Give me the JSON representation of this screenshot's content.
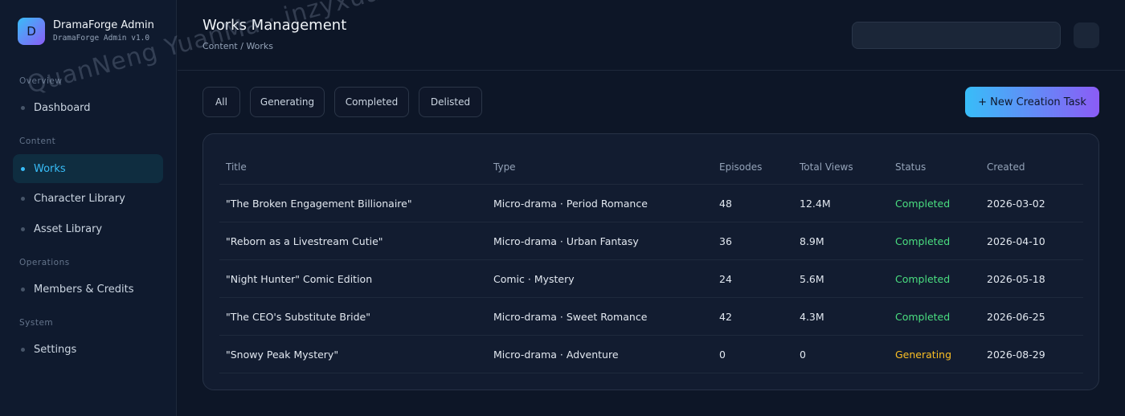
{
  "brand": {
    "logo_letter": "D",
    "title": "DramaForge Admin",
    "subtitle": "DramaForge Admin v1.0"
  },
  "sidebar": {
    "sections": [
      {
        "label": "Overview",
        "items": [
          {
            "label": "Dashboard"
          }
        ]
      },
      {
        "label": "Content",
        "items": [
          {
            "label": "Works",
            "active": true
          },
          {
            "label": "Character Library"
          },
          {
            "label": "Asset Library"
          }
        ]
      },
      {
        "label": "Operations",
        "items": [
          {
            "label": "Members & Credits"
          }
        ]
      },
      {
        "label": "System",
        "items": [
          {
            "label": "Settings"
          }
        ]
      }
    ]
  },
  "header": {
    "title": "Works Management",
    "breadcrumb": "Content / Works"
  },
  "filters": [
    "All",
    "Generating",
    "Completed",
    "Delisted"
  ],
  "new_task_label": "+ New Creation Task",
  "table": {
    "columns": [
      "Title",
      "Type",
      "Episodes",
      "Total Views",
      "Status",
      "Created"
    ],
    "rows": [
      {
        "title": "\"The Broken Engagement Billionaire\"",
        "type": "Micro-drama · Period Romance",
        "episodes": "48",
        "views": "12.4M",
        "status": "Completed",
        "created": "2026-03-02"
      },
      {
        "title": "\"Reborn as a Livestream Cutie\"",
        "type": "Micro-drama · Urban Fantasy",
        "episodes": "36",
        "views": "8.9M",
        "status": "Completed",
        "created": "2026-04-10"
      },
      {
        "title": "\"Night Hunter\" Comic Edition",
        "type": "Comic · Mystery",
        "episodes": "24",
        "views": "5.6M",
        "status": "Completed",
        "created": "2026-05-18"
      },
      {
        "title": "\"The CEO's Substitute Bride\"",
        "type": "Micro-drama · Sweet Romance",
        "episodes": "42",
        "views": "4.3M",
        "status": "Completed",
        "created": "2026-06-25"
      },
      {
        "title": "\"Snowy Peak Mystery\"",
        "type": "Micro-drama · Adventure",
        "episodes": "0",
        "views": "0",
        "status": "Generating",
        "created": "2026-08-29"
      }
    ]
  },
  "colors": {
    "accent": "#38bdf8",
    "accent2": "#8b5cf6",
    "completed": "#4ade80",
    "generating": "#fbbf24"
  },
  "watermark": "QuanNeng YuanMa · inzyxuashop.com"
}
